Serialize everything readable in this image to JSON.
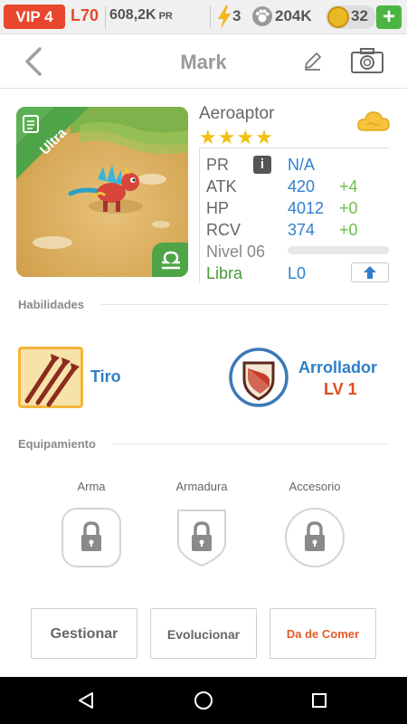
{
  "topbar": {
    "vip": "VIP 4",
    "level": "L70",
    "power_value": "608,2K",
    "power_unit": "PR",
    "energy": "3",
    "food": "204K",
    "gold": "32",
    "add_label": "+",
    "icons": [
      "lightning-icon",
      "paw-icon",
      "gold-coin-icon",
      "plus-icon"
    ]
  },
  "header": {
    "title": "Mark",
    "icons": [
      "back-chevron-icon",
      "edit-pencil-icon",
      "camera-icon"
    ]
  },
  "pet": {
    "rarity": "Ultra",
    "name": "Aeroaptor",
    "stars": "★★★★",
    "star_count": 4,
    "element_icon": "cloud-icon",
    "zodiac_icon": "libra-icon",
    "stats": {
      "pr_label": "PR",
      "pr_value": "N/A",
      "info_label": "i",
      "atk_label": "ATK",
      "atk_value": "420",
      "atk_bonus": "+4",
      "hp_label": "HP",
      "hp_value": "4012",
      "hp_bonus": "+0",
      "rcv_label": "RCV",
      "rcv_value": "374",
      "rcv_bonus": "+0",
      "nivel_label": "Nivel 06",
      "nivel_progress": 0,
      "zodiac_label": "Libra",
      "zodiac_level": "L0"
    }
  },
  "habilidades": {
    "title": "Habilidades",
    "skills": [
      {
        "name": "Tiro",
        "icon": "arrows-skill-icon"
      },
      {
        "name": "Arrollador",
        "level": "LV 1",
        "icon": "shield-skill-icon"
      }
    ]
  },
  "equipamiento": {
    "title": "Equipamiento",
    "slots": [
      {
        "label": "Arma",
        "shape": "rounded-square",
        "state": "locked"
      },
      {
        "label": "Armadura",
        "shape": "shield",
        "state": "locked"
      },
      {
        "label": "Accesorio",
        "shape": "circle",
        "state": "locked"
      }
    ]
  },
  "actions": {
    "manage": "Gestionar",
    "evolve": "Evolucionar",
    "feed": "Da de Comer"
  },
  "colors": {
    "vip_red": "#e8472e",
    "link_blue": "#2e7fc8",
    "bonus_green": "#6cc04a",
    "star_yellow": "#f3bf14",
    "feed_orange": "#e25a28",
    "ribbon_green": "#4ea447"
  }
}
